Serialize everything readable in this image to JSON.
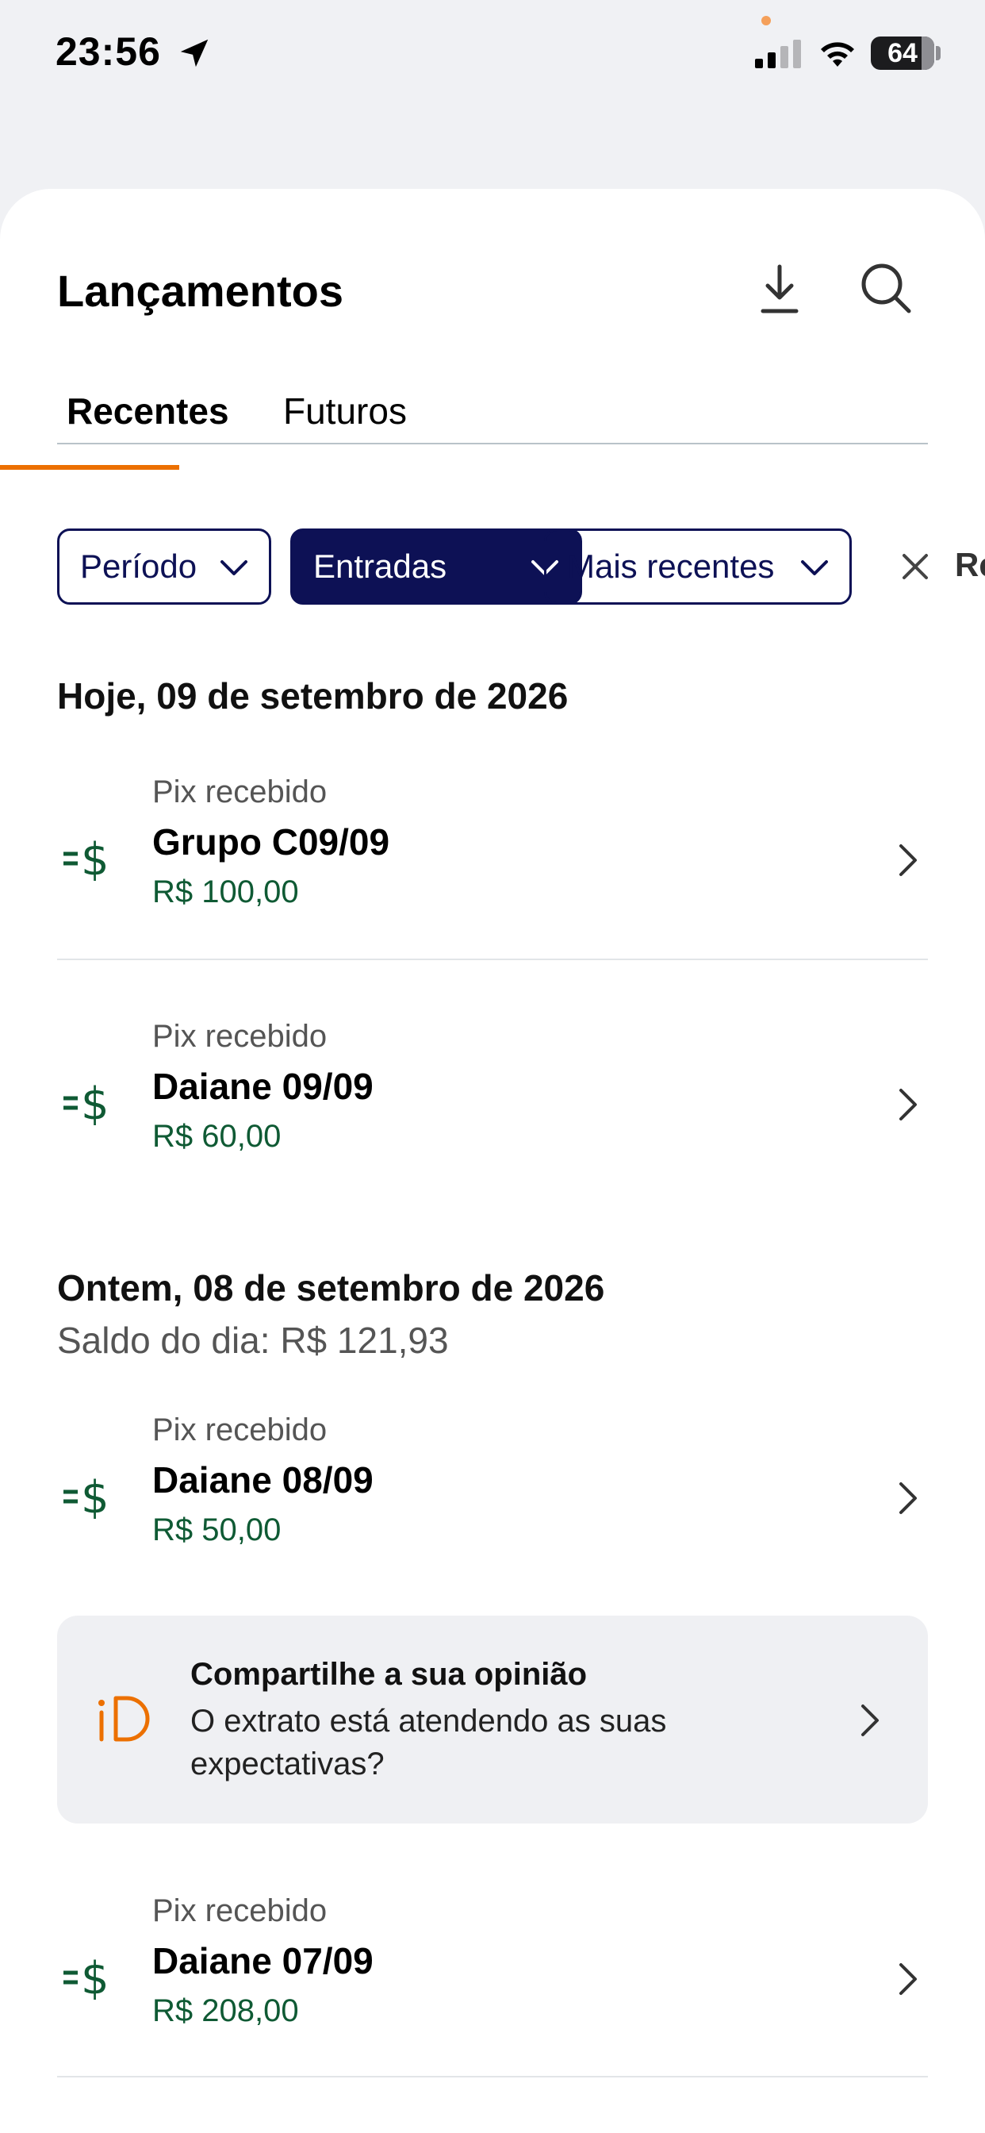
{
  "status_bar": {
    "time": "23:56",
    "battery": "64"
  },
  "header": {
    "title": "Lançamentos"
  },
  "tabs": [
    {
      "label": "Recentes",
      "active": true
    },
    {
      "label": "Futuros",
      "active": false
    }
  ],
  "filters": {
    "periodo": "Período",
    "entradas": "Entradas",
    "ordem": "Mais recentes",
    "clear": "Re"
  },
  "days": [
    {
      "header": "Hoje, 09 de setembro de 2026",
      "transactions": [
        {
          "type": "Pix recebido",
          "name": "Grupo C09/09",
          "amount": "R$ 100,00"
        },
        {
          "type": "Pix recebido",
          "name": "Daiane 09/09",
          "amount": "R$ 60,00"
        }
      ]
    },
    {
      "header": "Ontem, 08 de setembro de 2026",
      "balance": "Saldo do dia: R$ 121,93",
      "transactions": [
        {
          "type": "Pix recebido",
          "name": "Daiane 08/09",
          "amount": "R$ 50,00"
        },
        {
          "type": "Pix recebido",
          "name": "Daiane 07/09",
          "amount": "R$ 208,00"
        }
      ]
    }
  ],
  "feedback": {
    "title": "Compartilhe a sua opinião",
    "text": "O extrato está atendendo as suas expectativas?"
  },
  "colors": {
    "accent": "#ec7000",
    "navy": "#0d1155",
    "amount_green": "#0f5a34"
  }
}
